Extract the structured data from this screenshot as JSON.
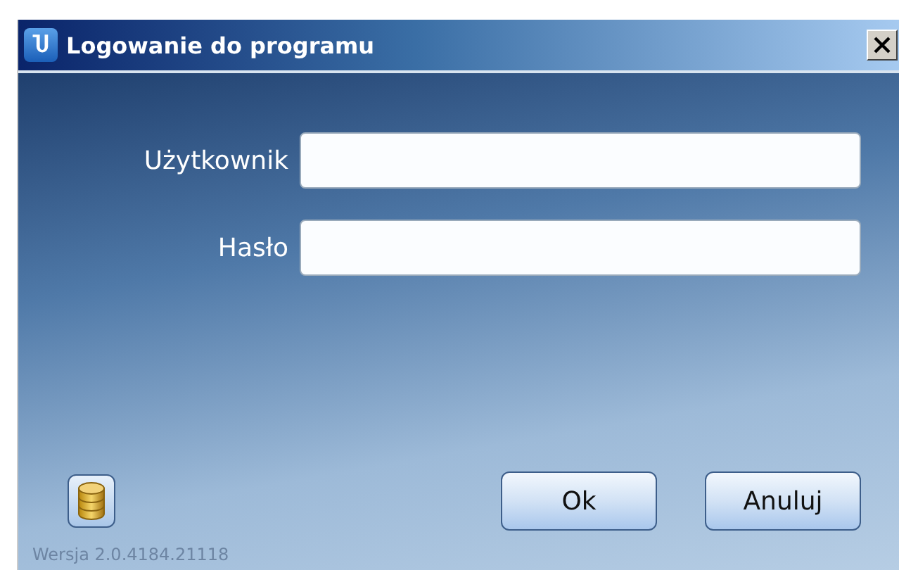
{
  "window": {
    "title": "Logowanie do programu",
    "logo": "Ⴎ"
  },
  "fields": [
    {
      "label": "Użytkownik"
    },
    {
      "label": "Hasło"
    }
  ],
  "buttons": [
    {
      "label": "Ok"
    },
    {
      "label": "Anuluj"
    }
  ],
  "version": "Wersja 2.0.4184.21118"
}
